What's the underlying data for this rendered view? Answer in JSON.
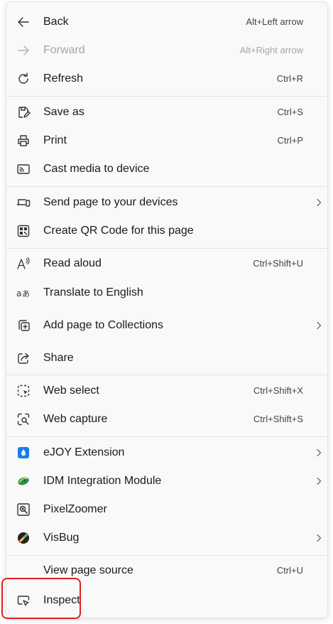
{
  "menu": {
    "back": {
      "label": "Back",
      "shortcut": "Alt+Left arrow"
    },
    "forward": {
      "label": "Forward",
      "shortcut": "Alt+Right arrow"
    },
    "refresh": {
      "label": "Refresh",
      "shortcut": "Ctrl+R"
    },
    "save_as": {
      "label": "Save as",
      "shortcut": "Ctrl+S"
    },
    "print": {
      "label": "Print",
      "shortcut": "Ctrl+P"
    },
    "cast": {
      "label": "Cast media to device"
    },
    "send_page": {
      "label": "Send page to your devices"
    },
    "qr_code": {
      "label": "Create QR Code for this page"
    },
    "read_aloud": {
      "label": "Read aloud",
      "shortcut": "Ctrl+Shift+U"
    },
    "translate": {
      "label": "Translate to English"
    },
    "collections": {
      "label": "Add page to Collections"
    },
    "share": {
      "label": "Share"
    },
    "web_select": {
      "label": "Web select",
      "shortcut": "Ctrl+Shift+X"
    },
    "web_capture": {
      "label": "Web capture",
      "shortcut": "Ctrl+Shift+S"
    },
    "ejoy": {
      "label": "eJOY Extension"
    },
    "idm": {
      "label": "IDM Integration Module"
    },
    "pixelzoomer": {
      "label": "PixelZoomer"
    },
    "visbug": {
      "label": "VisBug"
    },
    "view_source": {
      "label": "View page source",
      "shortcut": "Ctrl+U"
    },
    "inspect": {
      "label": "Inspect"
    }
  },
  "icons": {
    "back": "arrow-left-icon",
    "forward": "arrow-right-icon",
    "refresh": "refresh-icon",
    "save_as": "save-as-icon",
    "print": "printer-icon",
    "cast": "cast-icon",
    "send_page": "devices-icon",
    "qr_code": "qr-code-icon",
    "read_aloud": "read-aloud-icon",
    "translate": "translate-icon",
    "collections": "collections-add-icon",
    "share": "share-icon",
    "web_select": "web-select-icon",
    "web_capture": "web-capture-icon",
    "ejoy": "ejoy-drop-icon",
    "idm": "idm-icon",
    "pixelzoomer": "magnifier-icon",
    "visbug": "visbug-icon",
    "inspect": "inspect-icon"
  },
  "colors": {
    "highlight": "#e02020",
    "ejoy_blue": "#1a7ee8",
    "disabled_text": "#a5a5a5"
  }
}
